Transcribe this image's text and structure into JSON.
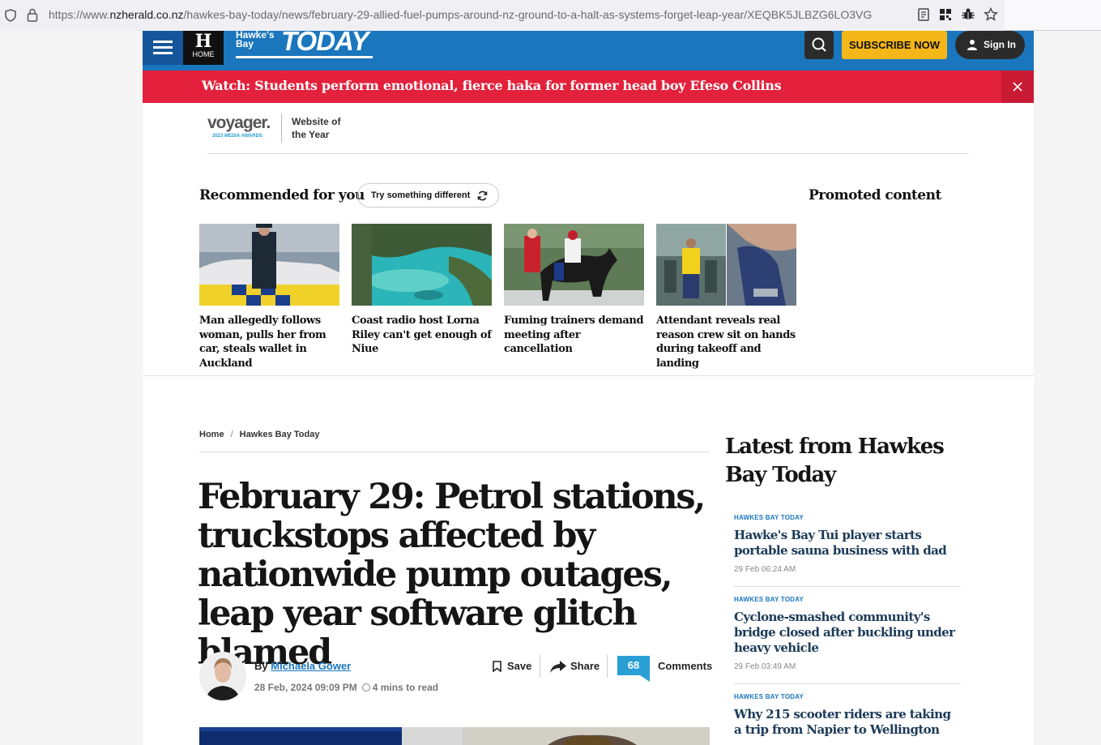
{
  "browser": {
    "url_prefix": "https://www.",
    "url_domain": "nzherald.co.nz",
    "url_path": "/hawkes-bay-today/news/february-29-allied-fuel-pumps-around-nz-ground-to-a-halt-as-systems-forget-leap-year/XEQBK5JLBZG6LO3VG"
  },
  "nav": {
    "home_label": "HOME",
    "home_glyph": "H",
    "logo_small": "Hawke's Bay",
    "logo_big": "TODAY",
    "subscribe_label": "SUBSCRIBE NOW",
    "signin_label": "Sign In"
  },
  "alert": {
    "text": "Watch: Students perform emotional, fierce haka for former head boy Efeso Collins"
  },
  "award": {
    "brand": "voyager.",
    "sub": "2023 MEDIA AWARDS",
    "text": "Website of the Year"
  },
  "recommended": {
    "title": "Recommended for you",
    "try_label": "Try something different",
    "promoted_title": "Promoted content",
    "cards": [
      {
        "caption": "Man allegedly follows woman, pulls her from car, steals wallet in Auckland"
      },
      {
        "caption": "Coast radio host Lorna Riley can't get enough of Niue"
      },
      {
        "caption": "Fuming trainers demand meeting after cancellation"
      },
      {
        "caption": "Attendant reveals real reason crew sit on hands during takeoff and landing"
      }
    ]
  },
  "article": {
    "breadcrumb_home": "Home",
    "breadcrumb_section": "Hawkes Bay Today",
    "headline": "February 29: Petrol stations, truckstops affected by nationwide pump outages, leap year software glitch blamed",
    "by_label": "By",
    "author": "Michaela Gower",
    "date": "28 Feb, 2024 09:09 PM",
    "read_time": "4 mins to read",
    "save_label": "Save",
    "share_label": "Share",
    "comments_count": "68",
    "comments_label": "Comments"
  },
  "latest": {
    "title": "Latest from Hawkes Bay Today",
    "items": [
      {
        "tag": "HAWKES BAY TODAY",
        "title": "Hawke's Bay Tui player starts portable sauna business with dad",
        "time": "29 Feb 06:24 AM"
      },
      {
        "tag": "HAWKES BAY TODAY",
        "title": "Cyclone-smashed community's bridge closed after buckling under heavy vehicle",
        "time": "29 Feb 03:49 AM"
      },
      {
        "tag": "HAWKES BAY TODAY",
        "title": "Why 215 scooter riders are taking a trip from Napier to Wellington",
        "time": ""
      }
    ]
  },
  "colors": {
    "brand_blue": "#1a76bd",
    "alert_red": "#e3213c",
    "subscribe_yellow": "#f5b61a",
    "comments_blue": "#2a9fd6"
  }
}
